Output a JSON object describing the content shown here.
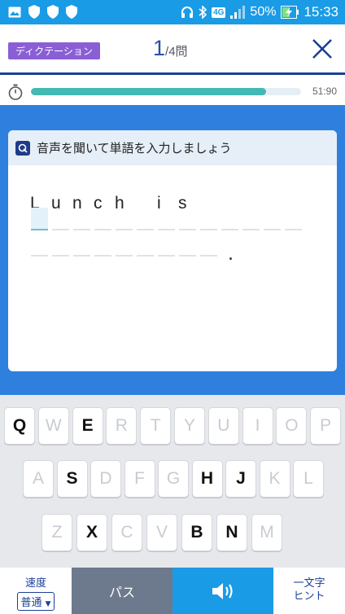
{
  "status_bar": {
    "battery": "50%",
    "time": "15:33",
    "network": "4G"
  },
  "header": {
    "mode_label": "ディクテーション",
    "current": "1",
    "total": "/4問"
  },
  "timer": {
    "value": "51:90",
    "progress": 0.87
  },
  "card": {
    "title": "音声を聞いて単語を入力しましょう",
    "sentence_letters": [
      "L",
      "u",
      "n",
      "c",
      "h",
      "",
      "i",
      "s"
    ],
    "blanks_row1": 13,
    "blanks_row2": 9,
    "period": "."
  },
  "keyboard": {
    "rows": [
      [
        {
          "k": "Q",
          "on": true
        },
        {
          "k": "W",
          "on": false
        },
        {
          "k": "E",
          "on": true
        },
        {
          "k": "R",
          "on": false
        },
        {
          "k": "T",
          "on": false
        },
        {
          "k": "Y",
          "on": false
        },
        {
          "k": "U",
          "on": false
        },
        {
          "k": "I",
          "on": false
        },
        {
          "k": "O",
          "on": false
        },
        {
          "k": "P",
          "on": false
        }
      ],
      [
        {
          "k": "A",
          "on": false
        },
        {
          "k": "S",
          "on": true
        },
        {
          "k": "D",
          "on": false
        },
        {
          "k": "F",
          "on": false
        },
        {
          "k": "G",
          "on": false
        },
        {
          "k": "H",
          "on": true
        },
        {
          "k": "J",
          "on": true
        },
        {
          "k": "K",
          "on": false
        },
        {
          "k": "L",
          "on": false
        }
      ],
      [
        {
          "k": "Z",
          "on": false
        },
        {
          "k": "X",
          "on": true
        },
        {
          "k": "C",
          "on": false
        },
        {
          "k": "V",
          "on": false
        },
        {
          "k": "B",
          "on": true
        },
        {
          "k": "N",
          "on": true
        },
        {
          "k": "M",
          "on": false
        }
      ]
    ]
  },
  "bottom": {
    "speed_label": "速度",
    "speed_value": "普通",
    "pass_label": "パス",
    "sound_icon": "speaker-icon",
    "hint_line1": "一文字",
    "hint_line2": "ヒント"
  },
  "colors": {
    "status_bar": "#1a9be6",
    "accent_blue": "#2f7fde",
    "mode_badge": "#8a5fd6",
    "timer_fill": "#43b9b3",
    "pass_button": "#6d7a8d"
  }
}
